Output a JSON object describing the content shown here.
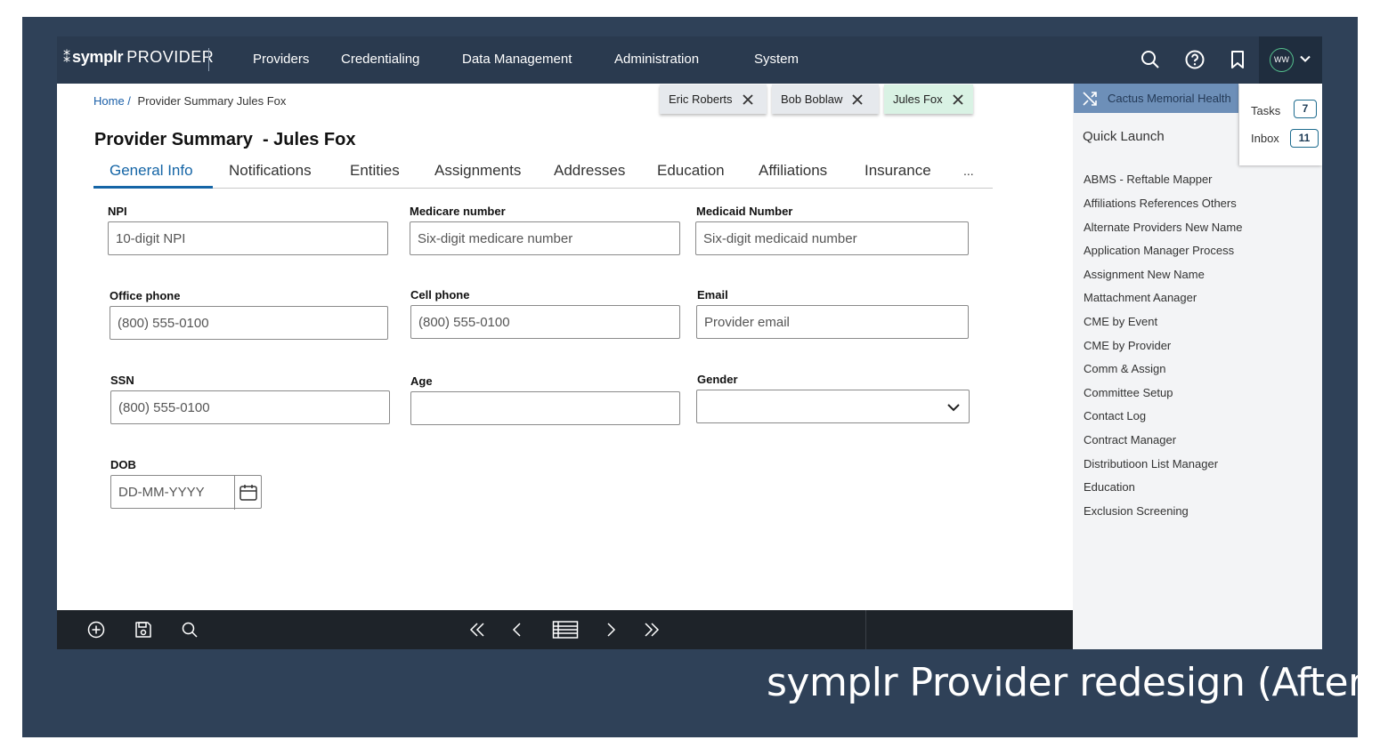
{
  "header": {
    "brand": "symplr",
    "product": "PROVIDER",
    "nav": [
      "Providers",
      "Credentialing",
      "Data Management",
      "Administration",
      "System"
    ],
    "user_initials": "WW"
  },
  "breadcrumb": {
    "home": "Home /",
    "current": "Provider Summary Jules Fox"
  },
  "open_tabs": [
    {
      "label": "Eric Roberts"
    },
    {
      "label": "Bob Boblaw"
    },
    {
      "label": "Jules Fox"
    }
  ],
  "page_title": "Provider Summary  - Jules Fox",
  "tabs": [
    "General Info",
    "Notifications",
    "Entities",
    "Assignments",
    "Addresses",
    "Education",
    "Affiliations",
    "Insurance",
    "..."
  ],
  "form": {
    "npi": {
      "label": "NPI",
      "placeholder": "10-digit NPI"
    },
    "medicare": {
      "label": "Medicare number",
      "placeholder": "Six-digit medicare number"
    },
    "medicaid": {
      "label": "Medicaid Number",
      "placeholder": "Six-digit medicaid number"
    },
    "office_phone": {
      "label": "Office phone",
      "placeholder": "(800) 555-0100"
    },
    "cell_phone": {
      "label": "Cell phone",
      "placeholder": "(800) 555-0100"
    },
    "email": {
      "label": "Email",
      "placeholder": "Provider email"
    },
    "ssn": {
      "label": "SSN",
      "placeholder": "(800) 555-0100"
    },
    "age": {
      "label": "Age",
      "placeholder": ""
    },
    "gender": {
      "label": "Gender",
      "value": ""
    },
    "dob": {
      "label": "DOB",
      "placeholder": "DD-MM-YYYY"
    }
  },
  "right_panel": {
    "organization": "Cactus Memorial Health",
    "quick_launch_title": "Quick Launch",
    "quick_launch": [
      "ABMS - Reftable Mapper",
      "Affiliations References Others",
      "Alternate Providers New Name",
      "Application Manager Process",
      "Assignment New Name",
      "Mattachment Aanager",
      "CME by Event",
      "CME by Provider",
      "Comm & Assign",
      "Committee Setup",
      "Contact Log",
      "Contract Manager",
      "Distributioon List Manager",
      "Education",
      "Exclusion Screening"
    ],
    "tasks": {
      "label": "Tasks",
      "count": "7"
    },
    "inbox": {
      "label": "Inbox",
      "count": "11"
    }
  },
  "caption": "symplr Provider redesign (After)",
  "colors": {
    "nav_bg": "#2a3a4f",
    "accent": "#1565a6",
    "active_tab": "#d9f2e4",
    "slide_bg": "#2f4158"
  }
}
